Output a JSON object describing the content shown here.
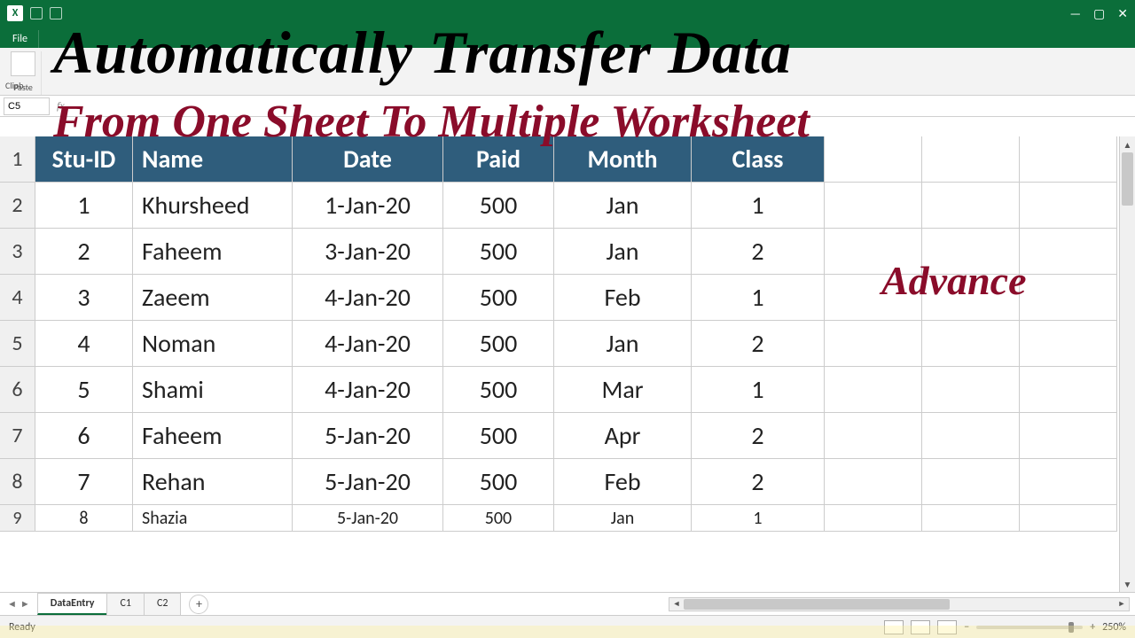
{
  "overlay": {
    "h1": "Automatically Transfer Data",
    "h2": "From One Sheet To Multiple Worksheet",
    "h3": "Advance"
  },
  "title": "Excel",
  "ribbon": {
    "file": "File",
    "paste": "Paste",
    "group_clipboard": "Clipb…"
  },
  "namebox": "C5",
  "columns": [
    "Stu-ID",
    "Name",
    "Date",
    "Paid",
    "Month",
    "Class"
  ],
  "rows": [
    {
      "stu": "1",
      "name": "Khursheed",
      "date": "1-Jan-20",
      "paid": "500",
      "month": "Jan",
      "cls": "1"
    },
    {
      "stu": "2",
      "name": "Faheem",
      "date": "3-Jan-20",
      "paid": "500",
      "month": "Jan",
      "cls": "2"
    },
    {
      "stu": "3",
      "name": "Zaeem",
      "date": "4-Jan-20",
      "paid": "500",
      "month": "Feb",
      "cls": "1"
    },
    {
      "stu": "4",
      "name": "Noman",
      "date": "4-Jan-20",
      "paid": "500",
      "month": "Jan",
      "cls": "2"
    },
    {
      "stu": "5",
      "name": "Shami",
      "date": "4-Jan-20",
      "paid": "500",
      "month": "Mar",
      "cls": "1"
    },
    {
      "stu": "6",
      "name": "Faheem",
      "date": "5-Jan-20",
      "paid": "500",
      "month": "Apr",
      "cls": "2"
    },
    {
      "stu": "7",
      "name": "Rehan",
      "date": "5-Jan-20",
      "paid": "500",
      "month": "Feb",
      "cls": "2"
    },
    {
      "stu": "8",
      "name": "Shazia",
      "date": "5-Jan-20",
      "paid": "500",
      "month": "Jan",
      "cls": "1"
    }
  ],
  "row_labels": [
    "1",
    "2",
    "3",
    "4",
    "5",
    "6",
    "7",
    "8",
    "9"
  ],
  "sheets": {
    "active": "DataEntry",
    "others": [
      "C1",
      "C2"
    ]
  },
  "status": {
    "ready": "Ready",
    "zoom": "250%"
  },
  "icons": {
    "minus": "−",
    "plus": "+"
  }
}
